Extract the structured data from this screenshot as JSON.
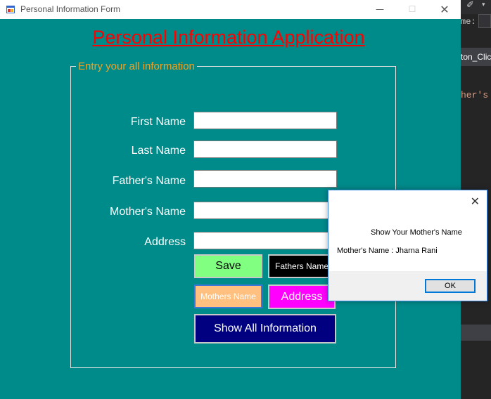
{
  "window": {
    "title": "Personal Information Form",
    "minimize_glyph": "—",
    "maximize_glyph": "☐",
    "close_glyph": "✕"
  },
  "heading": "Personal Information Application",
  "group_label": "Entry your all information",
  "fields": {
    "first_name": {
      "label": "First Name",
      "value": ""
    },
    "last_name": {
      "label": "Last Name",
      "value": ""
    },
    "fathers_name": {
      "label": "Father's Name",
      "value": ""
    },
    "mothers_name": {
      "label": "Mother's Name",
      "value": ""
    },
    "address": {
      "label": "Address",
      "value": ""
    }
  },
  "buttons": {
    "save": "Save",
    "fathers_name": "Fathers Name",
    "mothers_name": "Mothers Name",
    "address": "Address",
    "show_all": "Show All Information"
  },
  "message_box": {
    "caption": "Show Your Mother's Name",
    "text": "Mother's Name : Jharna Rani",
    "ok": "OK",
    "close_glyph": "✕"
  },
  "ide_background": {
    "name_label": "me:",
    "tab_text": "ton_Clic",
    "code_text": "her's N"
  },
  "colors": {
    "form_background": "#008b8b",
    "heading": "#ff0000",
    "group_label": "#f4a020",
    "save_button": "#80ff80",
    "fathers_button": "#000000",
    "mothers_button": "#ffc080",
    "address_button": "#ff00ff",
    "show_all_button": "#000080"
  }
}
